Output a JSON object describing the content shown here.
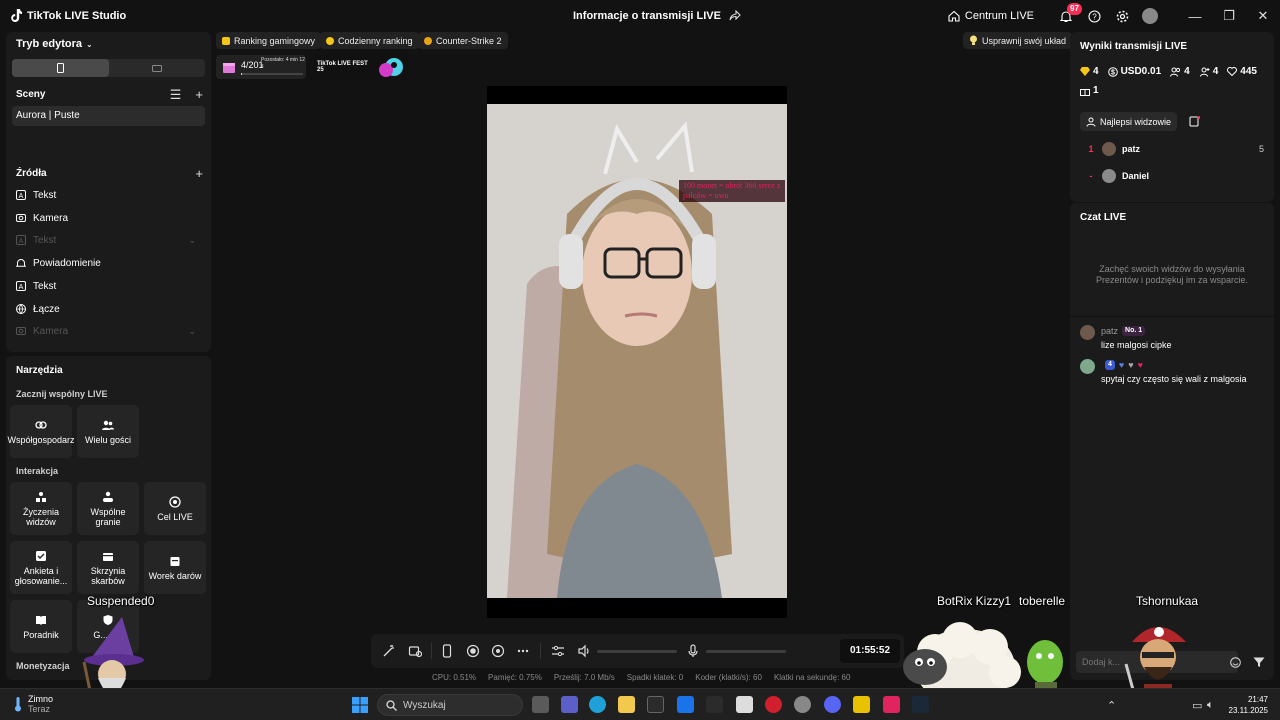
{
  "window": {
    "app_title": "TikTok LIVE Studio",
    "center_title": "Informacje o transmisji LIVE",
    "centrum_label": "Centrum LIVE",
    "notification_count": "97"
  },
  "editor": {
    "mode_label": "Tryb edytora",
    "scenes_label": "Sceny",
    "scene_item": "Aurora | Puste",
    "sources_label": "Źródła",
    "sources": [
      {
        "label": "Tekst",
        "icon": "text-icon",
        "dim": false
      },
      {
        "label": "Kamera",
        "icon": "camera-icon",
        "dim": false
      },
      {
        "label": "Tekst",
        "icon": "text-icon",
        "dim": true
      },
      {
        "label": "Powiadomienie",
        "icon": "bell-icon",
        "dim": false
      },
      {
        "label": "Tekst",
        "icon": "text-icon",
        "dim": false
      },
      {
        "label": "Łącze",
        "icon": "globe-icon",
        "dim": false
      },
      {
        "label": "Kamera",
        "icon": "camera-icon",
        "dim": true
      }
    ]
  },
  "tools": {
    "title": "Narzędzia",
    "section_joint": "Zacznij wspólny LIVE",
    "cohost": "Współgospodarz",
    "multi_guest": "Wielu gości",
    "section_interaction": "Interakcja",
    "wishes": "Życzenia widzów",
    "joint_play": "Wspólne granie",
    "live_goal": "Cel LIVE",
    "poll": "Ankieta i głosowanie...",
    "treasure": "Skrzynia skarbów",
    "gift_bag": "Worek darów",
    "guide": "Poradnik",
    "partial_tool": "G... P...",
    "section_monetization": "Monetyzacja"
  },
  "top_chips": {
    "gaming_ranking": "Ranking gamingowy",
    "daily_ranking": "Codzienny ranking",
    "game": "Counter-Strike 2",
    "improve_layout": "Usprawnij swój układ",
    "goal_count": "4/201",
    "goal_time": "Pozostało: 4 min 12 s",
    "goal_progress": 0.02,
    "livefest": "TikTok LIVE FEST 25"
  },
  "preview": {
    "overlay_text": "100 monet = obrót 360 serce z palców = uwu"
  },
  "controls": {
    "timer": "01:55:52"
  },
  "stats": {
    "cpu": "CPU:  0.51%",
    "memory": "Pamięć:  0.75%",
    "sent": "Prześlij:  7.0 Mb/s",
    "dropped": "Spadki klatek:  0",
    "encoder": "Koder (klatki/s):  60",
    "fps": "Klatki na sekundę:  60"
  },
  "results": {
    "title": "Wyniki transmisji LIVE",
    "diamonds": "4",
    "usd": "USD0.01",
    "viewers": "4",
    "new_followers": "4",
    "likes": "445",
    "gifts": "1",
    "top_viewers_label": "Najlepsi widzowie",
    "top_viewers": [
      {
        "rank": "1",
        "name": "patz",
        "score": "5"
      },
      {
        "rank": "-",
        "name": "Daniel",
        "score": ""
      }
    ]
  },
  "chat": {
    "title": "Czat LIVE",
    "hint": "Zachęć swoich widzów do wysyłania Prezentów i podziękuj im za wsparcie.",
    "messages": [
      {
        "user": "patz",
        "badge": "No. 1",
        "text": "lize malgosi cipke"
      },
      {
        "user": "",
        "badge": "4",
        "text": "spytaj czy często się wali z malgosia"
      }
    ],
    "input_placeholder": "Dodaj k..."
  },
  "overlay_names": {
    "left": "Suspended0",
    "right1": "BotRix Kizzy1",
    "right2": "toberelle",
    "right3": "Tshornukaa"
  },
  "taskbar": {
    "weather_title": "Zimno",
    "weather_sub": "Teraz",
    "search": "Wyszukaj",
    "time": "21:47",
    "date": "23.11.2025"
  }
}
